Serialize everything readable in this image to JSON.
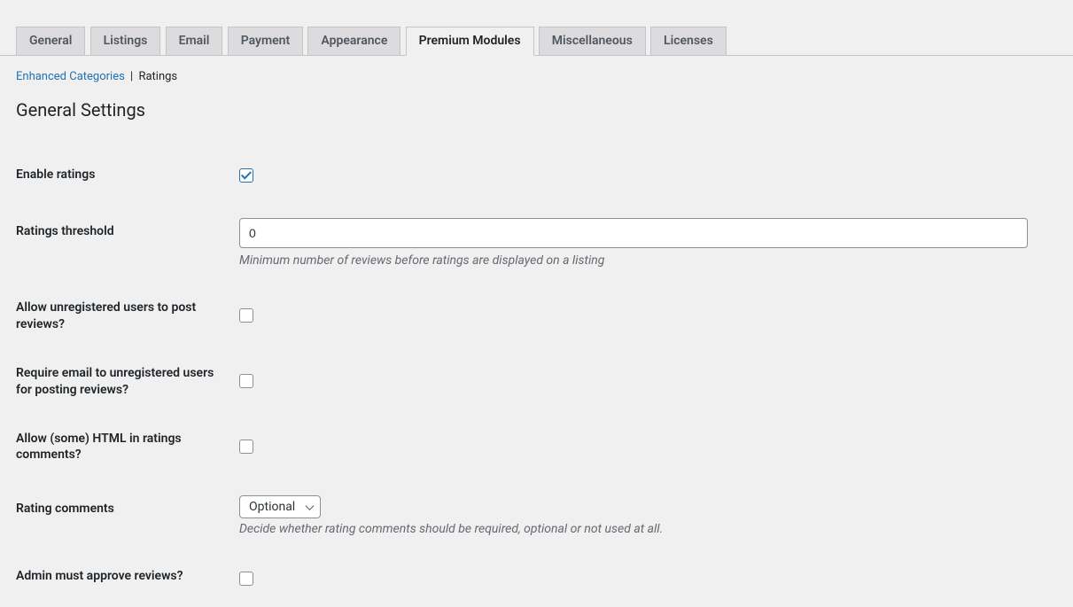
{
  "tabs": [
    {
      "label": "General"
    },
    {
      "label": "Listings"
    },
    {
      "label": "Email"
    },
    {
      "label": "Payment"
    },
    {
      "label": "Appearance"
    },
    {
      "label": "Premium Modules"
    },
    {
      "label": "Miscellaneous"
    },
    {
      "label": "Licenses"
    }
  ],
  "subnav": {
    "enhanced": "Enhanced Categories",
    "sep": "|",
    "ratings": "Ratings"
  },
  "heading": "General Settings",
  "fields": {
    "enable_ratings": {
      "label": "Enable ratings"
    },
    "ratings_threshold": {
      "label": "Ratings threshold",
      "value": "0",
      "description": "Minimum number of reviews before ratings are displayed on a listing"
    },
    "allow_unregistered": {
      "label": "Allow unregistered users to post reviews?"
    },
    "require_email": {
      "label": "Require email to unregistered users for posting reviews?"
    },
    "allow_html": {
      "label": "Allow (some) HTML in ratings comments?"
    },
    "rating_comments": {
      "label": "Rating comments",
      "value": "Optional",
      "description": "Decide whether rating comments should be required, optional or not used at all."
    },
    "admin_approve": {
      "label": "Admin must approve reviews?"
    }
  }
}
